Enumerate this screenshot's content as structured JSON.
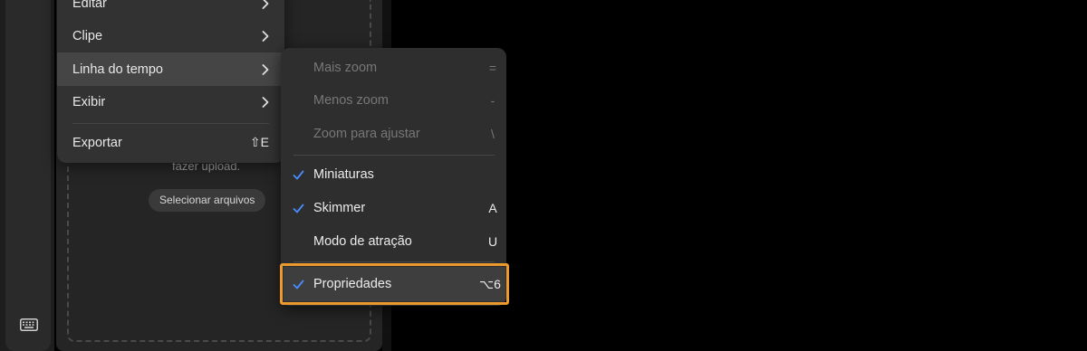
{
  "upload_panel": {
    "upload_text": "fazer upload.",
    "select_files_button": "Selecionar arquivos"
  },
  "menu": {
    "items": [
      {
        "label": "Editar",
        "has_submenu": true
      },
      {
        "label": "Clipe",
        "has_submenu": true
      },
      {
        "label": "Linha do tempo",
        "has_submenu": true,
        "active": true
      },
      {
        "label": "Exibir",
        "has_submenu": true
      },
      {
        "label": "Exportar",
        "shortcut": "⇧E"
      }
    ]
  },
  "submenu": {
    "items": [
      {
        "label": "Mais zoom",
        "shortcut": "=",
        "enabled": false,
        "checked": false
      },
      {
        "label": "Menos zoom",
        "shortcut": "-",
        "enabled": false,
        "checked": false
      },
      {
        "label": "Zoom para ajustar",
        "shortcut": "\\",
        "enabled": false,
        "checked": false
      },
      {
        "label": "Miniaturas",
        "shortcut": "",
        "enabled": true,
        "checked": true
      },
      {
        "label": "Skimmer",
        "shortcut": "A",
        "enabled": true,
        "checked": true
      },
      {
        "label": "Modo de atração",
        "shortcut": "U",
        "enabled": true,
        "checked": false
      },
      {
        "label": "Propriedades",
        "shortcut": "⌥6",
        "enabled": true,
        "checked": true,
        "highlighted": true
      }
    ]
  },
  "icons": {
    "toolbar": "keyboard-icon",
    "submenu_arrow": "chevron-right-icon",
    "check": "checkmark-icon"
  },
  "colors": {
    "checkmark": "#4a8cff",
    "highlight_border": "#ec9a2e"
  }
}
